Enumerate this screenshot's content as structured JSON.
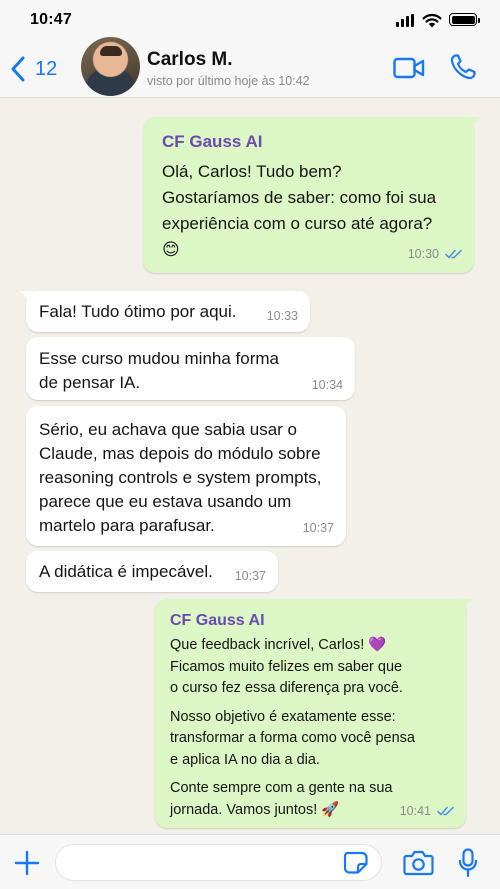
{
  "status_bar": {
    "time": "10:47"
  },
  "header": {
    "back_count": "12",
    "contact_name": "Carlos M.",
    "contact_status": "visto por último hoje às 10:42",
    "icons": {
      "back": "chevron-left-icon",
      "video": "video-camera-icon",
      "call": "phone-icon"
    }
  },
  "colors": {
    "accent": "#1877f2",
    "outgoing_bubble": "#dcf7c5",
    "incoming_bubble": "#ffffff",
    "sender_name": "#6a4bb0",
    "read_ticks": "#4a90e2",
    "chat_background": "#f3efe9"
  },
  "messages": [
    {
      "direction": "outgoing",
      "sender": "CF Gauss AI",
      "lines": [
        "Olá, Carlos! Tudo bem?",
        "Gostaríamos de saber: como foi sua",
        "experiência com o curso até agora?",
        "😊"
      ],
      "time": "10:30",
      "status": "read"
    },
    {
      "direction": "incoming",
      "lines": [
        "Fala! Tudo ótimo por aqui."
      ],
      "time": "10:33"
    },
    {
      "direction": "incoming",
      "lines": [
        "Esse curso mudou minha forma",
        "de pensar IA."
      ],
      "time": "10:34"
    },
    {
      "direction": "incoming",
      "lines": [
        "Sério, eu achava que sabia usar o",
        "Claude, mas depois do módulo sobre",
        "reasoning controls e system prompts,",
        "parece que eu estava usando um",
        "martelo para parafusar."
      ],
      "time": "10:37"
    },
    {
      "direction": "incoming",
      "lines": [
        "A didática é impecável."
      ],
      "time": "10:37"
    },
    {
      "direction": "outgoing",
      "sender": "CF Gauss AI",
      "paragraphs": [
        [
          "Que feedback incrível, Carlos! 💜",
          "Ficamos muito felizes em saber que",
          "o curso fez essa diferença pra você."
        ],
        [
          "Nosso objetivo é exatamente esse:",
          "transformar a forma como você pensa",
          "e aplica IA no dia a dia."
        ],
        [
          "Conte sempre com a gente na sua",
          "jornada. Vamos juntos! 🚀"
        ]
      ],
      "time": "10:41",
      "status": "read"
    }
  ],
  "input_bar": {
    "placeholder": "",
    "icons": {
      "attach": "plus-icon",
      "sticker": "sticker-icon",
      "camera": "camera-icon",
      "mic": "microphone-icon"
    }
  }
}
